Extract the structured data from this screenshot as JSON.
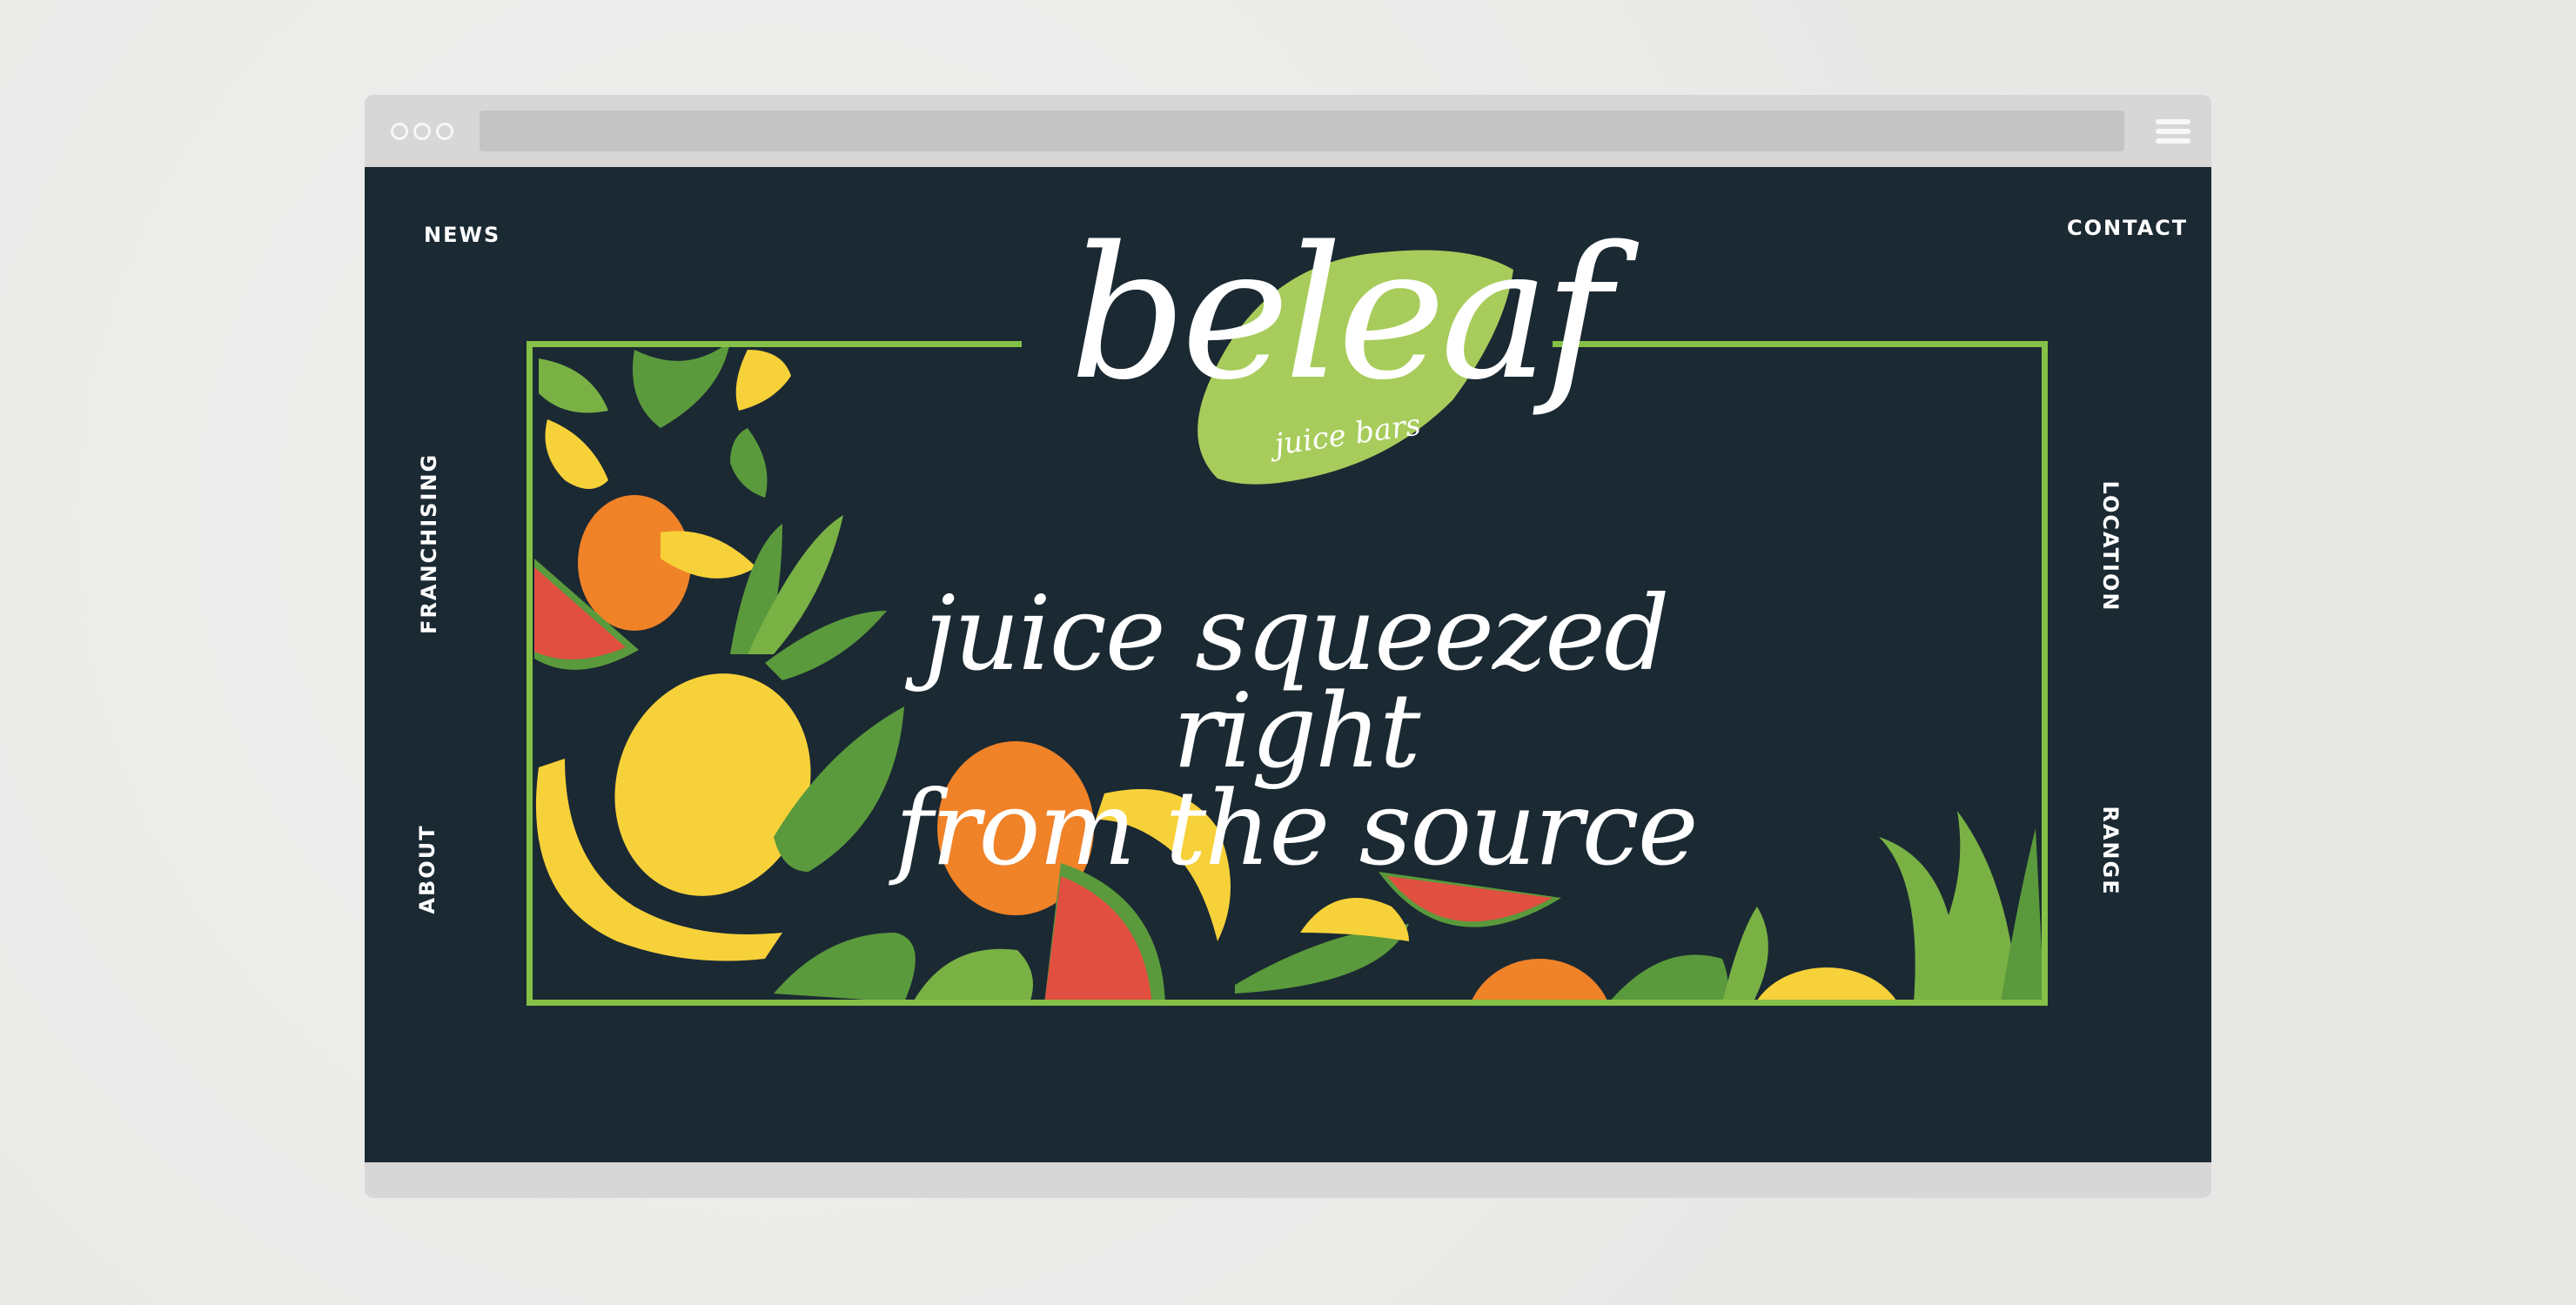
{
  "window": {
    "menu_icon": "hamburger-menu-icon",
    "dots_icon": "window-dots-icon"
  },
  "nav": {
    "news": "NEWS",
    "contact": "CONTACT",
    "franchising": "FRANCHISING",
    "about": "ABOUT",
    "location": "LOCATION",
    "range": "RANGE"
  },
  "logo": {
    "name": "beleaf",
    "tagline": "juice bars"
  },
  "hero": {
    "line1": "juice squeezed right",
    "line2": "from the source"
  },
  "colors": {
    "background": "#1b2933",
    "accent_green": "#84c146",
    "leaf_green": "#a7cc5b",
    "text": "#ffffff"
  }
}
